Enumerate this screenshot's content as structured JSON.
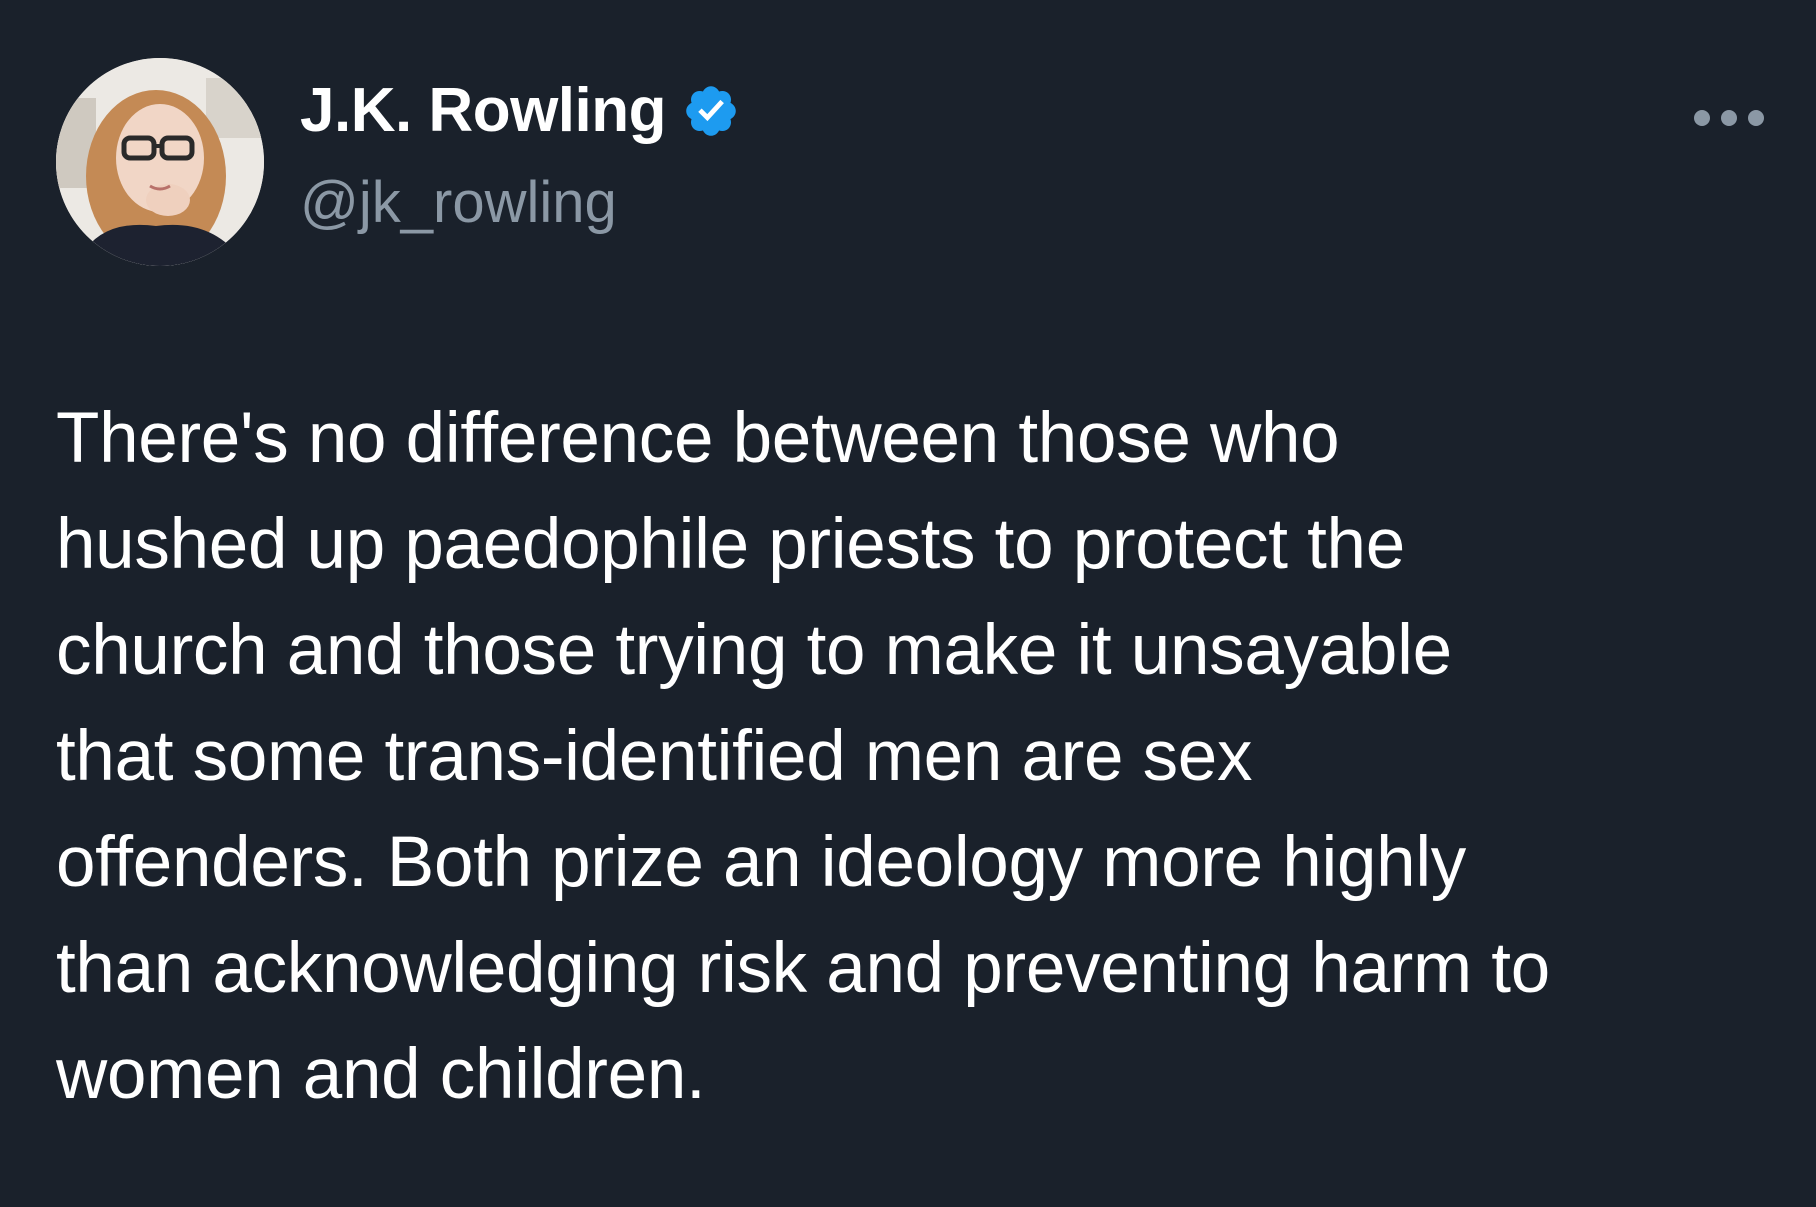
{
  "author": {
    "display_name": "J.K. Rowling",
    "handle": "@jk_rowling",
    "verified": true,
    "verified_badge_color": "#1d9bf0",
    "avatar_icon": "profile-photo"
  },
  "tweet": {
    "text_lines": [
      "There's no difference between those who",
      "hushed up paedophile priests to protect the",
      "church and those trying to make it unsayable",
      "that some trans-identified men are sex",
      "offenders. Both prize an ideology more highly",
      "than acknowledging risk and preventing harm to",
      "women and children."
    ]
  },
  "menu": {
    "icon": "more-options-icon"
  },
  "colors": {
    "background": "#1a212b",
    "text": "#ffffff",
    "secondary_text": "#8b98a5"
  }
}
